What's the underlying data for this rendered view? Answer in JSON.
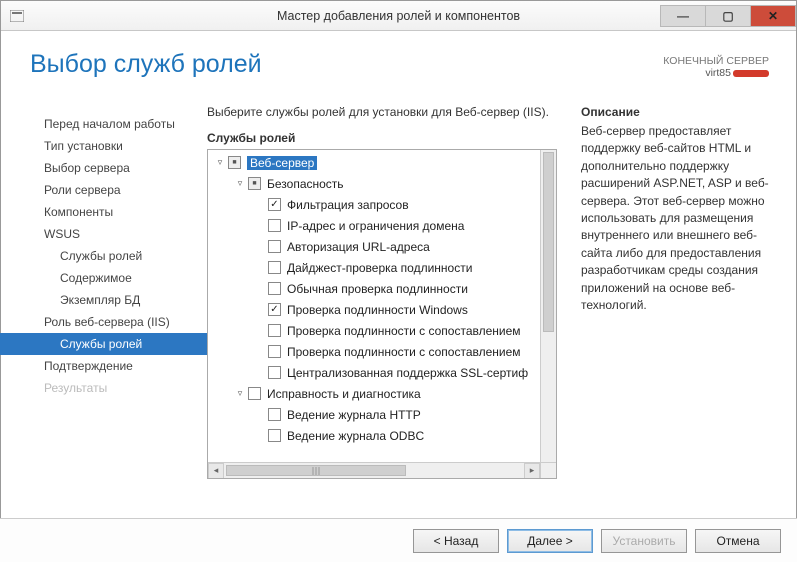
{
  "window": {
    "title": "Мастер добавления ролей и компонентов"
  },
  "page": {
    "heading": "Выбор служб ролей",
    "target_label": "КОНЕЧНЫЙ СЕРВЕР",
    "target_server": "virt85"
  },
  "sidebar": {
    "items": [
      {
        "label": "Перед началом работы"
      },
      {
        "label": "Тип установки"
      },
      {
        "label": "Выбор сервера"
      },
      {
        "label": "Роли сервера"
      },
      {
        "label": "Компоненты"
      },
      {
        "label": "WSUS"
      },
      {
        "label": "Службы ролей",
        "sub": true
      },
      {
        "label": "Содержимое",
        "sub": true
      },
      {
        "label": "Экземпляр БД",
        "sub": true
      },
      {
        "label": "Роль веб-сервера (IIS)"
      },
      {
        "label": "Службы ролей",
        "sub": true,
        "active": true
      },
      {
        "label": "Подтверждение"
      },
      {
        "label": "Результаты",
        "disabled": true
      }
    ]
  },
  "roles": {
    "instruction": "Выберите службы ролей для установки для Веб-сервер (IIS).",
    "label": "Службы ролей",
    "tree": [
      {
        "indent": 0,
        "expander": "▿",
        "state": "mixed",
        "text": "Веб-сервер",
        "selected": true
      },
      {
        "indent": 1,
        "expander": "▿",
        "state": "mixed",
        "text": "Безопасность"
      },
      {
        "indent": 2,
        "expander": "",
        "state": "checked",
        "text": "Фильтрация запросов"
      },
      {
        "indent": 2,
        "expander": "",
        "state": "unchecked",
        "text": "IP-адрес и ограничения домена"
      },
      {
        "indent": 2,
        "expander": "",
        "state": "unchecked",
        "text": "Авторизация URL-адреса"
      },
      {
        "indent": 2,
        "expander": "",
        "state": "unchecked",
        "text": "Дайджест-проверка подлинности"
      },
      {
        "indent": 2,
        "expander": "",
        "state": "unchecked",
        "text": "Обычная проверка подлинности"
      },
      {
        "indent": 2,
        "expander": "",
        "state": "checked",
        "text": "Проверка подлинности Windows"
      },
      {
        "indent": 2,
        "expander": "",
        "state": "unchecked",
        "text": "Проверка подлинности с сопоставлением"
      },
      {
        "indent": 2,
        "expander": "",
        "state": "unchecked",
        "text": "Проверка подлинности с сопоставлением"
      },
      {
        "indent": 2,
        "expander": "",
        "state": "unchecked",
        "text": "Централизованная поддержка SSL-сертиф"
      },
      {
        "indent": 1,
        "expander": "▿",
        "state": "unchecked",
        "text": "Исправность и диагностика"
      },
      {
        "indent": 2,
        "expander": "",
        "state": "unchecked",
        "text": "Ведение журнала HTTP"
      },
      {
        "indent": 2,
        "expander": "",
        "state": "unchecked",
        "text": "Ведение журнала ODBC"
      }
    ]
  },
  "description": {
    "label": "Описание",
    "text": "Веб-сервер предоставляет поддержку веб-сайтов HTML и дополнительно поддержку расширений ASP.NET, ASP и веб-сервера. Этот веб-сервер можно использовать для размещения внутреннего или внешнего веб-сайта либо для предоставления разработчикам среды создания приложений на основе веб-технологий."
  },
  "footer": {
    "back": "< Назад",
    "next": "Далее >",
    "install": "Установить",
    "cancel": "Отмена"
  }
}
